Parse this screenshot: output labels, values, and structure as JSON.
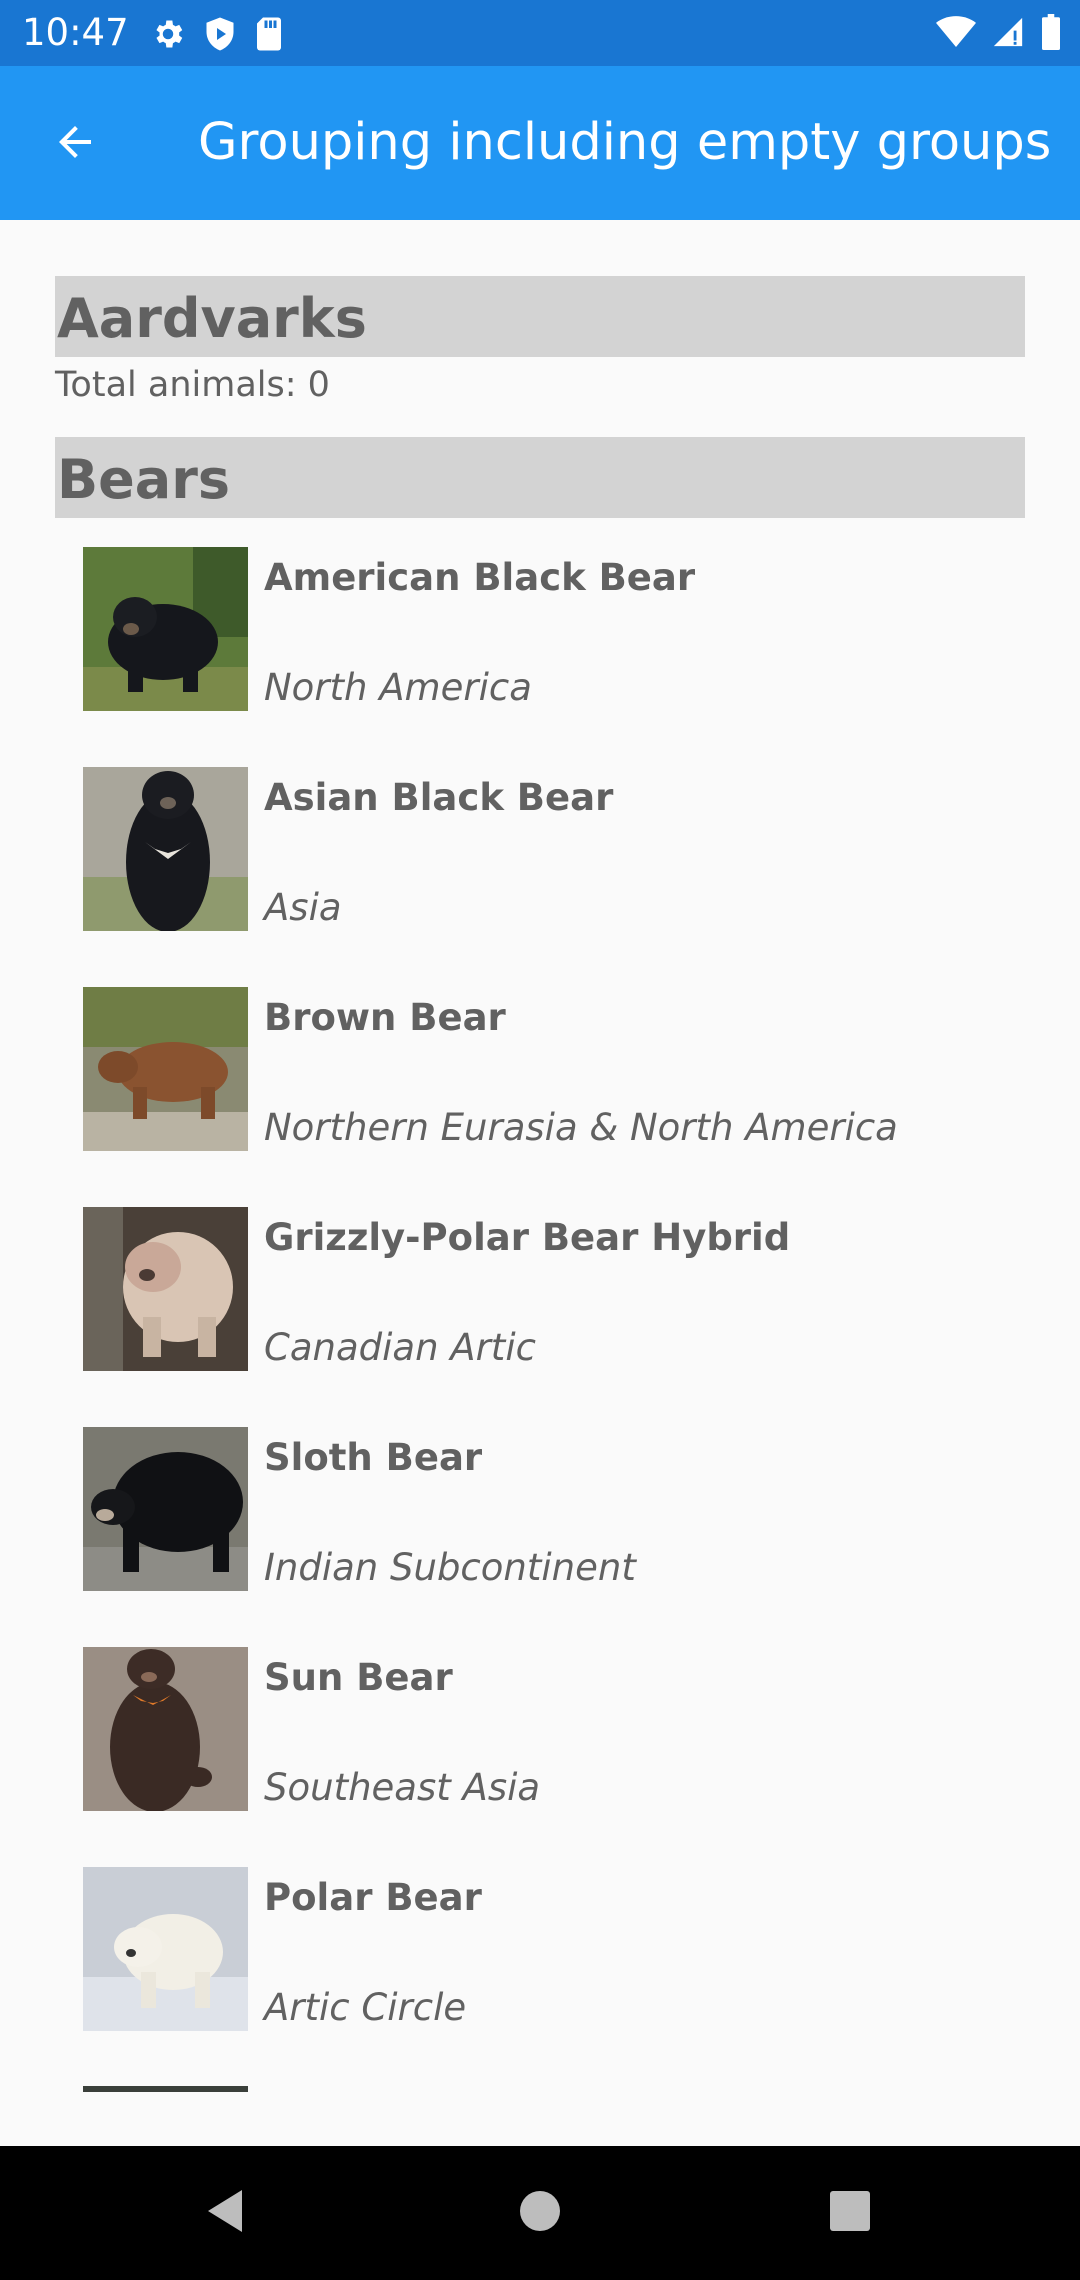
{
  "status_bar": {
    "time": "10:47",
    "icons_left": [
      "gear-icon",
      "shield-play-icon",
      "sd-card-icon"
    ],
    "icons_right": [
      "wifi-icon",
      "signal-icon",
      "battery-icon"
    ]
  },
  "app_bar": {
    "title": "Grouping including empty groups",
    "back_icon": "arrow-back-icon"
  },
  "groups": [
    {
      "header": "Aardvarks",
      "footer": "Total animals: 0",
      "items": []
    },
    {
      "header": "Bears",
      "items": [
        {
          "name": "American Black Bear",
          "location": "North America"
        },
        {
          "name": "Asian Black Bear",
          "location": "Asia"
        },
        {
          "name": "Brown Bear",
          "location": "Northern Eurasia & North America"
        },
        {
          "name": "Grizzly-Polar Bear Hybrid",
          "location": "Canadian Artic"
        },
        {
          "name": "Sloth Bear",
          "location": "Indian Subcontinent"
        },
        {
          "name": "Sun Bear",
          "location": "Southeast Asia"
        },
        {
          "name": "Polar Bear",
          "location": "Artic Circle"
        }
      ]
    }
  ],
  "nav_bar": {
    "icons": [
      "back-triangle-icon",
      "home-circle-icon",
      "recents-square-icon"
    ]
  },
  "colors": {
    "status_bar": "#1976d2",
    "app_bar": "#2196f3",
    "group_header_bg": "#d3d3d3",
    "text": "#616161",
    "background": "#fafafa"
  }
}
